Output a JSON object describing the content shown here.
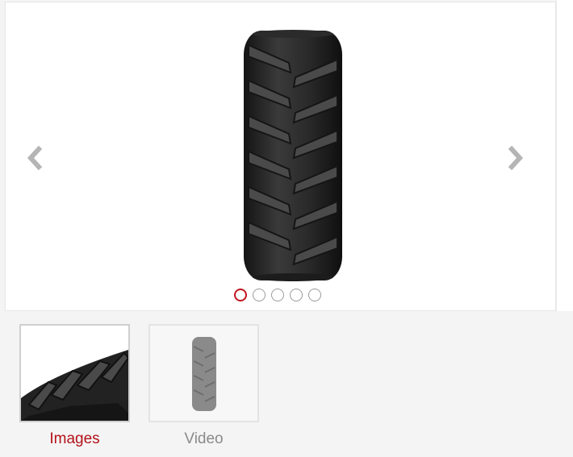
{
  "gallery": {
    "slides_total": 5,
    "active_slide": 1
  },
  "tabs": [
    {
      "label": "Images",
      "active": true
    },
    {
      "label": "Video",
      "active": false
    }
  ],
  "colors": {
    "accent": "#c0161e",
    "label_active": "#b3121a",
    "label_inactive": "#8a8a8a",
    "arrow": "#b5b5b5"
  },
  "icons": {
    "prev": "chevron-left-icon",
    "next": "chevron-right-icon"
  }
}
